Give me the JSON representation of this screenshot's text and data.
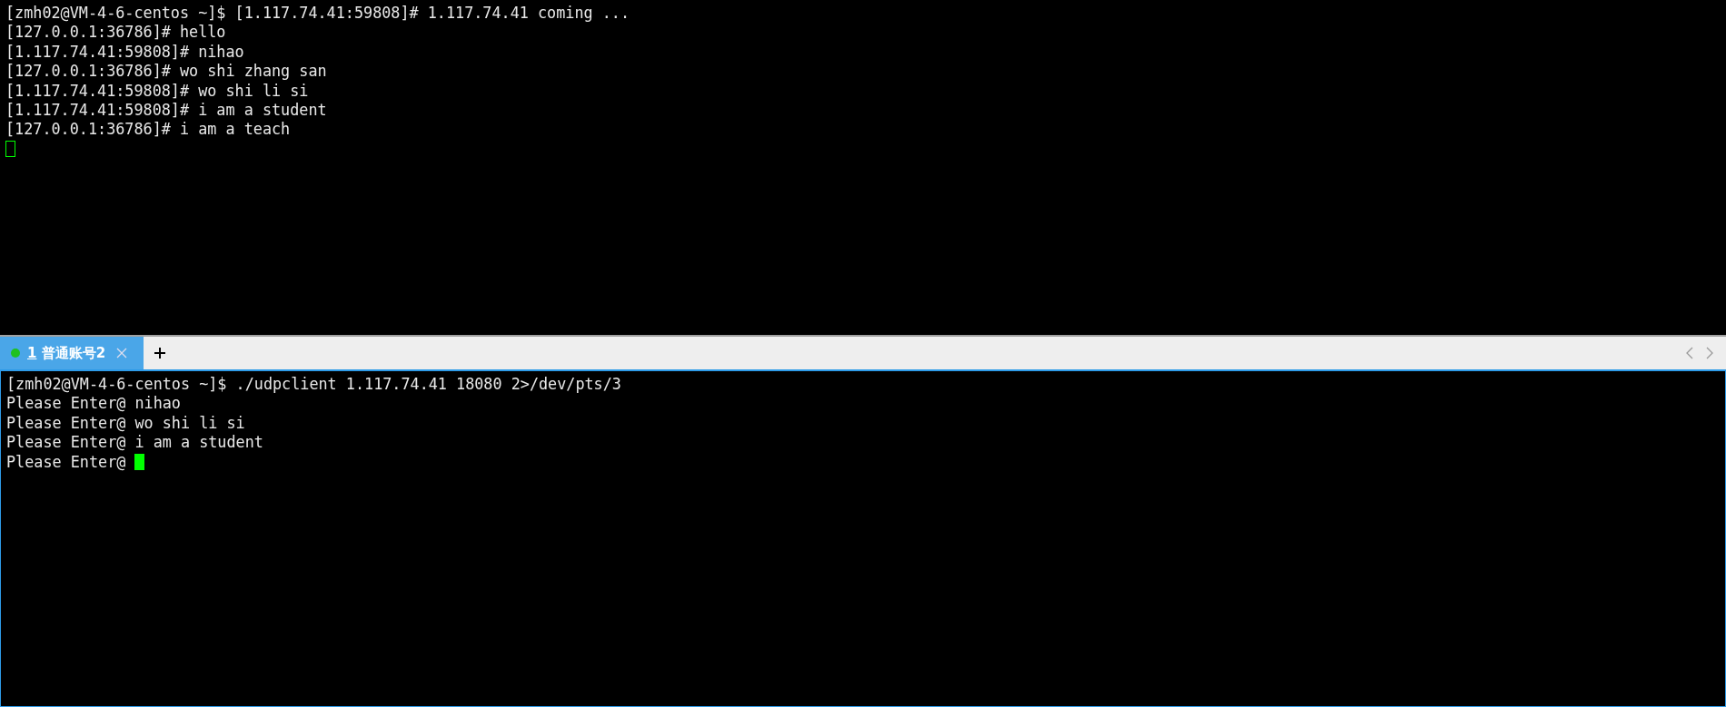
{
  "top_terminal": {
    "lines": [
      "[zmh02@VM-4-6-centos ~]$ [1.117.74.41:59808]# 1.117.74.41 coming ...",
      "[127.0.0.1:36786]# hello",
      "[1.117.74.41:59808]# nihao",
      "[127.0.0.1:36786]# wo shi zhang san",
      "[1.117.74.41:59808]# wo shi li si",
      "[1.117.74.41:59808]# i am a student",
      "[127.0.0.1:36786]# i am a teach"
    ],
    "cursor": {
      "filled": false
    }
  },
  "tabs": [
    {
      "number": "1",
      "label": "普通账号2",
      "selected": true
    }
  ],
  "bottom_terminal": {
    "lines": [
      "[zmh02@VM-4-6-centos ~]$ ./udpclient 1.117.74.41 18080 2>/dev/pts/3",
      "Please Enter@ nihao",
      "Please Enter@ wo shi li si",
      "Please Enter@ i am a student"
    ],
    "prompt": "Please Enter@",
    "cursor": {
      "filled": true
    }
  }
}
